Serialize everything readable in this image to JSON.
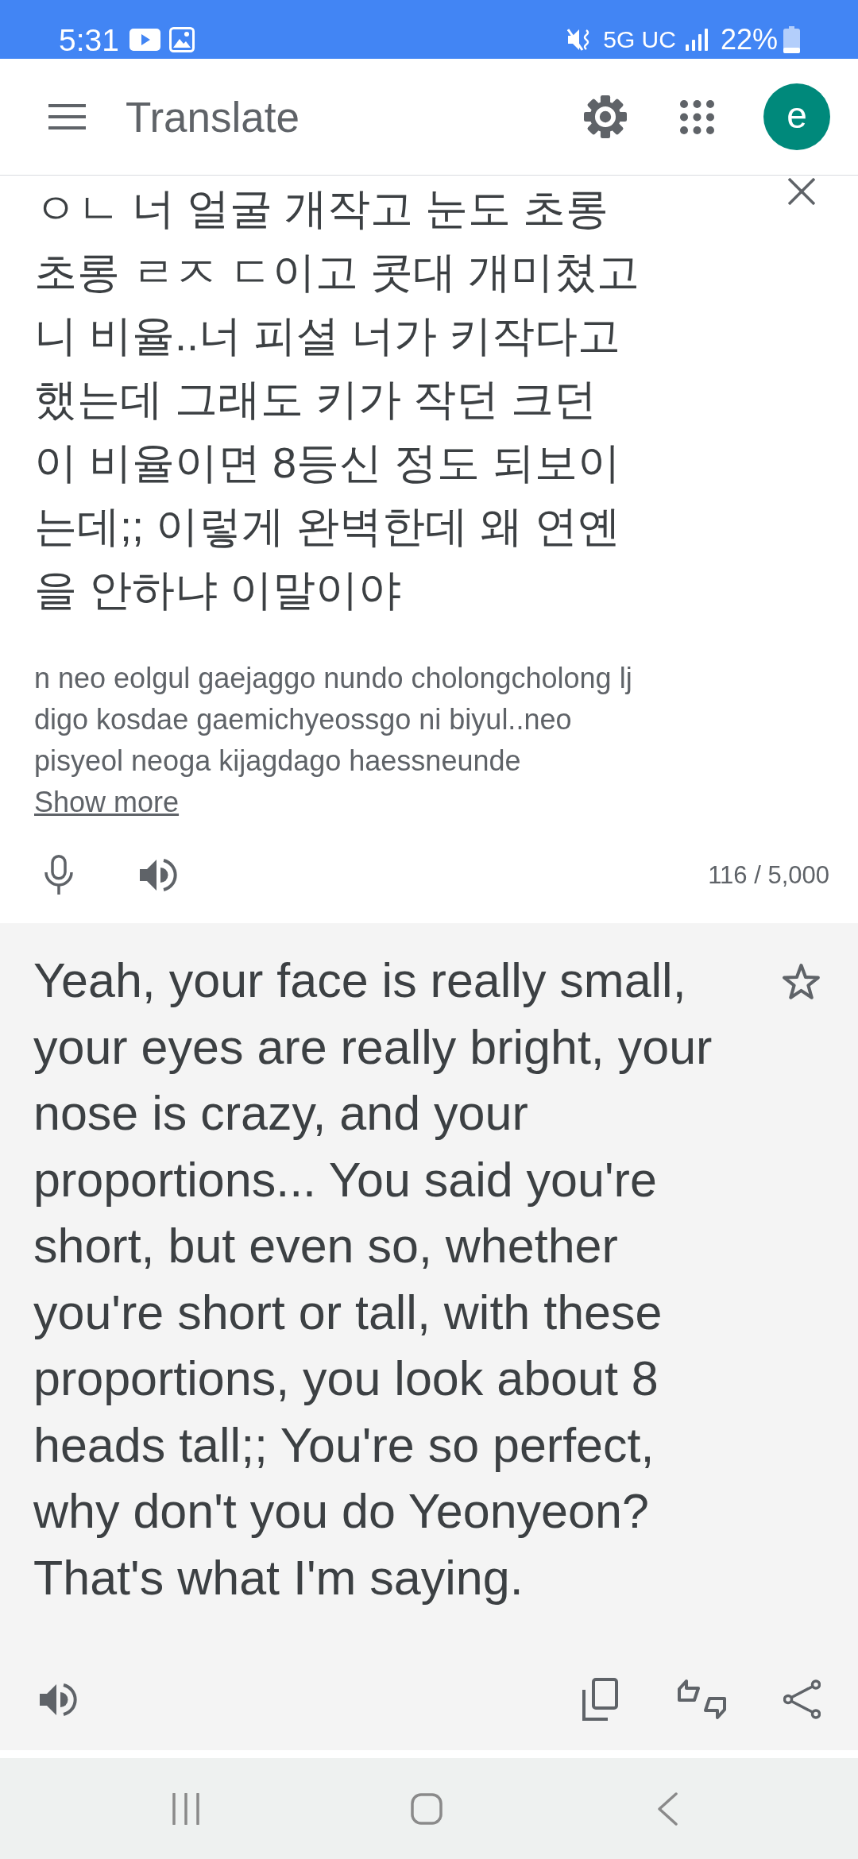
{
  "status_bar": {
    "time": "5:31",
    "network": "5G UC",
    "battery": "22%"
  },
  "app_bar": {
    "title": "Translate",
    "account_initial": "e"
  },
  "source": {
    "text": "ㅇㄴ 너 얼굴 개작고 눈도 초롱초롱 ㄹㅈ ㄷ이고 콧대 개미쳤고 니 비율..너 피셜 너가 키작다고 했는데 그래도 키가 작던 크던 이 비율이면 8등신 정도 되보이는데;; 이렇게 완벽한데 왜 연옌을 안하냐 이말이야",
    "romanization": "n neo eolgul gaejaggo nundo cholongcholong lj digo kosdae gaemichyeossgo ni biyul..neo pisyeol neoga kijagdago haessneunde",
    "show_more": "Show more",
    "char_count": "116 / 5,000"
  },
  "translation": {
    "text": "Yeah, your face is really small, your eyes are really bright, your nose is crazy, and your proportions... You said you're short, but even so, whether you're short or tall, with these proportions, you look about 8 heads tall;; You're so perfect, why don't you do Yeonyeon? That's what I'm saying.",
    "starred": false
  }
}
